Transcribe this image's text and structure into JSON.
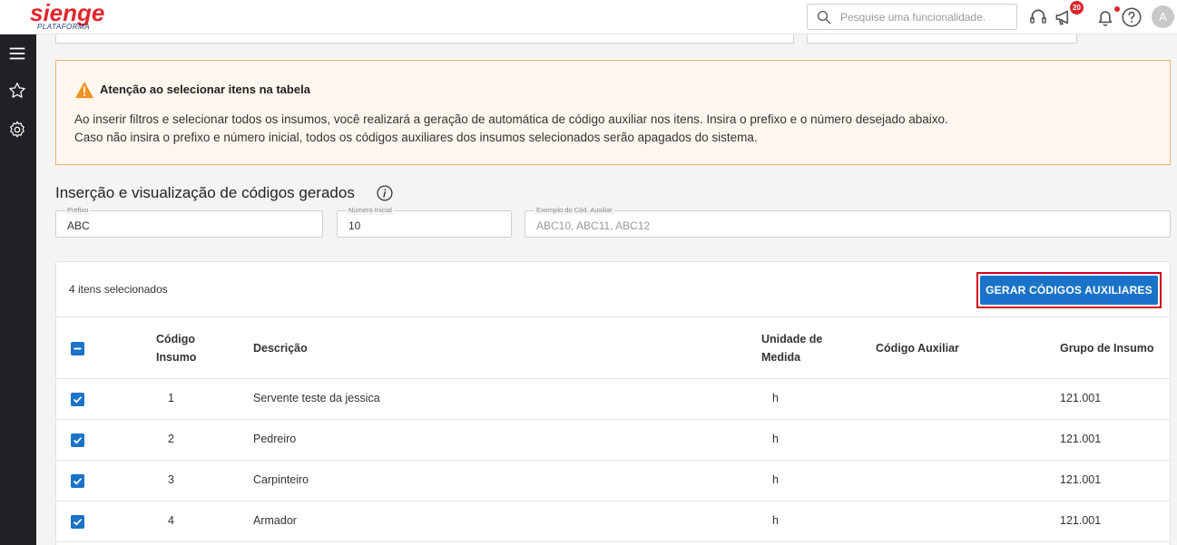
{
  "header": {
    "logo_main": "sienge",
    "logo_sub": "PLATAFORMA",
    "search_placeholder": "Pesquise uma funcionalidade.",
    "notifications_count": "20",
    "avatar_initial": "A"
  },
  "alert": {
    "title": "Atenção ao selecionar itens na tabela",
    "line1": "Ao inserir filtros e selecionar todos os insumos, você realizará a geração de automática de código auxiliar nos itens. Insira o prefixo e o número desejado abaixo.",
    "line2": "Caso não insira o prefixo e número inicial, todos os códigos auxiliares dos insumos selecionados serão apagados do sistema."
  },
  "section": {
    "title": "Inserção e visualização de códigos gerados"
  },
  "fields": {
    "prefix_label": "Prefixo",
    "prefix_value": "ABC",
    "start_label": "Número Inicial",
    "start_value": "10",
    "example_label": "Exemplo do Cód. Auxiliar",
    "example_value": "ABC10, ABC11, ABC12"
  },
  "table": {
    "selected_text": "4 itens selecionados",
    "generate_button": "GERAR CÓDIGOS AUXILIARES",
    "headers": {
      "code_line1": "Código",
      "code_line2": "Insumo",
      "description": "Descrição",
      "unit_line1": "Unidade de",
      "unit_line2": "Medida",
      "aux_code": "Código Auxiliar",
      "group": "Grupo de Insumo"
    },
    "rows": [
      {
        "code": "1",
        "description": "Servente teste da jessica",
        "unit": "h",
        "aux": "",
        "group": "121.001"
      },
      {
        "code": "2",
        "description": "Pedreiro",
        "unit": "h",
        "aux": "",
        "group": "121.001"
      },
      {
        "code": "3",
        "description": "Carpinteiro",
        "unit": "h",
        "aux": "",
        "group": "121.001"
      },
      {
        "code": "4",
        "description": "Armador",
        "unit": "h",
        "aux": "",
        "group": "121.001"
      }
    ]
  },
  "colors": {
    "brand_red": "#e0262d",
    "primary_blue": "#1a73c8",
    "alert_border": "#f0b070",
    "warning_orange": "#f29120",
    "sidebar_bg": "#202124"
  }
}
